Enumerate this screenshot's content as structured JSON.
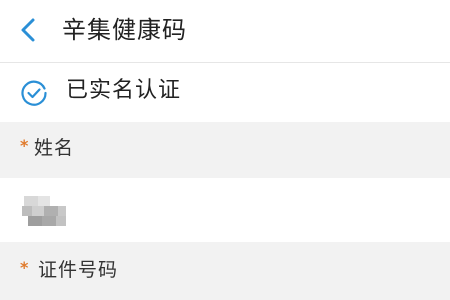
{
  "header": {
    "title": "辛集健康码",
    "back_icon": "chevron-left-icon"
  },
  "verification": {
    "status_text": "已实名认证",
    "icon": "check-circle-icon"
  },
  "form": {
    "name_field": {
      "required_mark": "*",
      "label": "姓名",
      "value_state": "blurred"
    },
    "id_field": {
      "required_mark": "*",
      "label": "证件号码"
    }
  },
  "colors": {
    "accent": "#2a8fd6",
    "required": "#e07a2c",
    "section_bg": "#f2f2f2",
    "text": "#222222"
  }
}
